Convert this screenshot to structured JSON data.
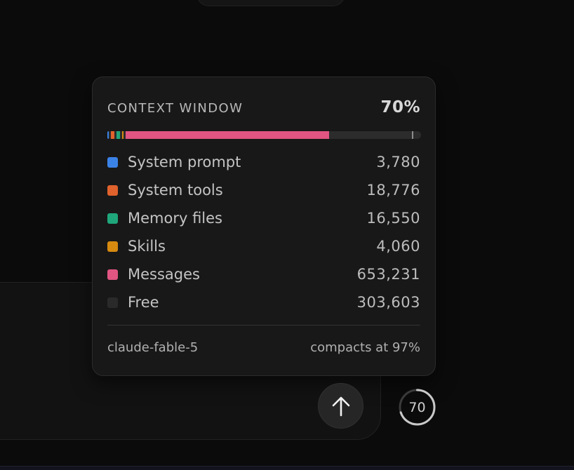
{
  "popover": {
    "title": "CONTEXT WINDOW",
    "percent": "70%",
    "usage_fraction": 0.7,
    "compact_fraction": 0.97,
    "rows": [
      {
        "label": "System prompt",
        "value": "3,780",
        "color": "#3b82e6"
      },
      {
        "label": "System tools",
        "value": "18,776",
        "color": "#e0622c"
      },
      {
        "label": "Memory files",
        "value": "16,550",
        "color": "#1fa67a"
      },
      {
        "label": "Skills",
        "value": "4,060",
        "color": "#d68a10"
      },
      {
        "label": "Messages",
        "value": "653,231",
        "color": "#e05582"
      },
      {
        "label": "Free",
        "value": "303,603",
        "color": "#2a2a2a"
      }
    ],
    "model": "claude-fable-5",
    "compacts_at": "compacts at 97%"
  },
  "composer": {
    "send_icon": "arrow-up-icon",
    "usage_ring_value": "70",
    "usage_ring_fraction": 0.7
  }
}
